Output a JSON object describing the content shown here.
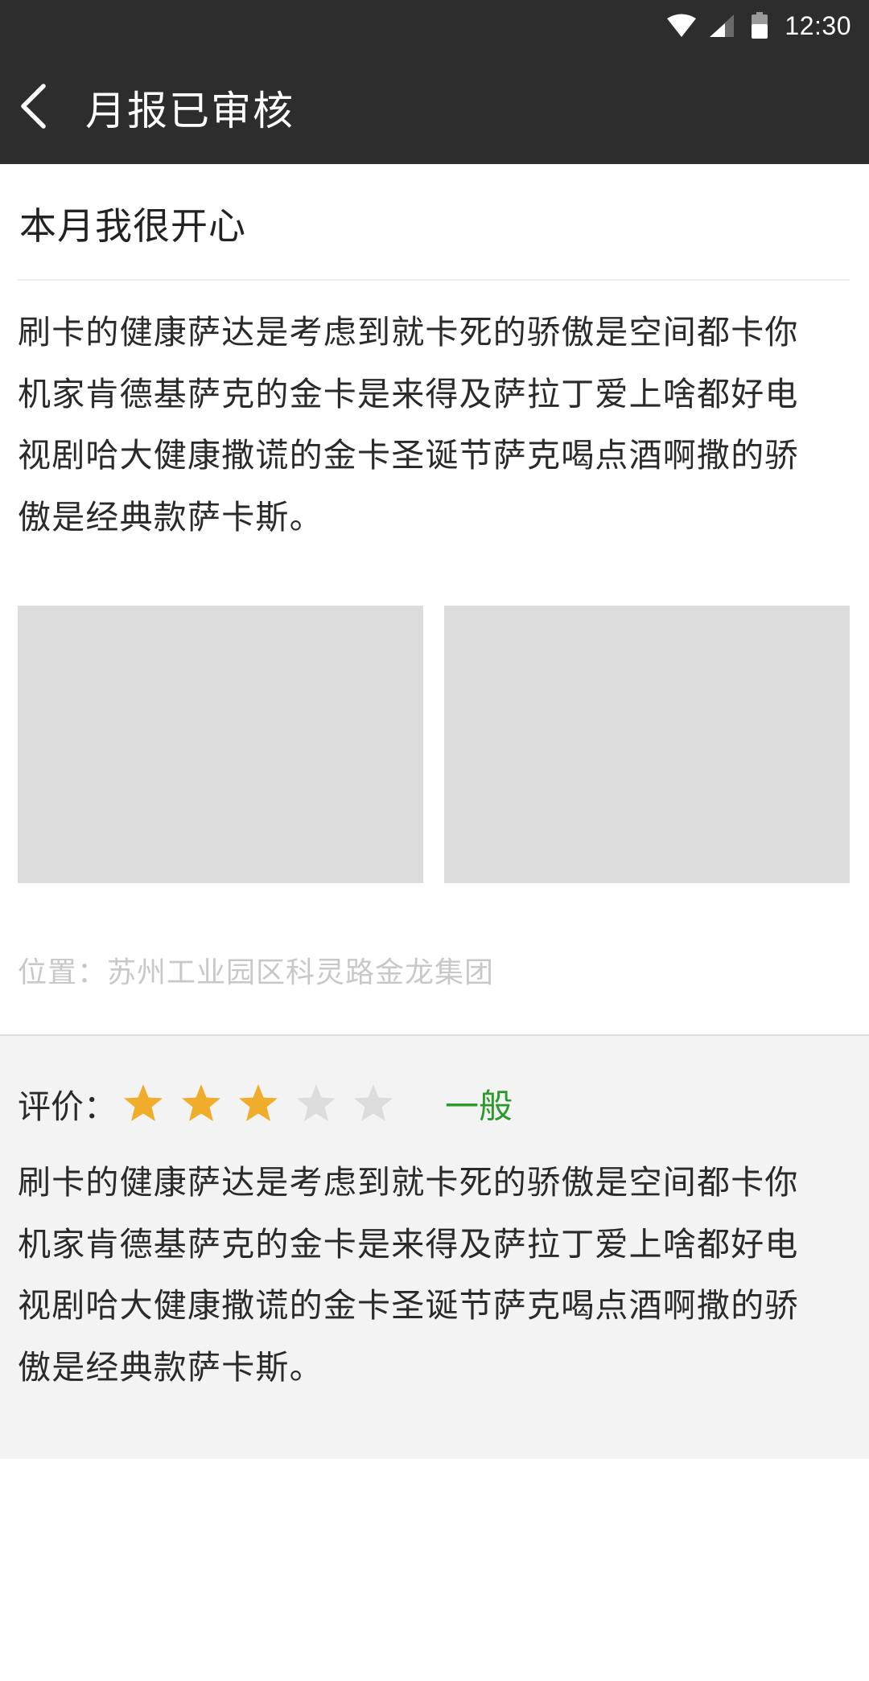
{
  "status_bar": {
    "time": "12:30",
    "icons": [
      "wifi-icon",
      "cellular-signal-icon",
      "battery-icon"
    ]
  },
  "app_bar": {
    "back_icon": "chevron-left-icon",
    "title": "月报已审核"
  },
  "article": {
    "title": "本月我很开心",
    "lines": [
      "刷卡的健康萨达是考虑到就卡死的骄傲是空间都卡你",
      "机家肯德基萨克的金卡是来得及萨拉丁爱上啥都好电",
      "视剧哈大健康撒谎的金卡圣诞节萨克喝点酒啊撒的骄",
      "傲是经典款萨卡斯。"
    ],
    "photo_count": 2,
    "location": "位置：苏州工业园区科灵路金龙集团"
  },
  "review": {
    "label": "评价：",
    "rating": 3,
    "max_rating": 5,
    "rating_text": "一般",
    "lines": [
      "刷卡的健康萨达是考虑到就卡死的骄傲是空间都卡你",
      "机家肯德基萨克的金卡是来得及萨拉丁爱上啥都好电",
      "视剧哈大健康撒谎的金卡圣诞节萨克喝点酒啊撒的骄",
      "傲是经典款萨卡斯。"
    ]
  },
  "colors": {
    "app_bar_bg": "#2d2d2d",
    "star_filled": "#f0ad2c",
    "star_empty": "#dcdcdc",
    "rating_text": "#2b9a2b",
    "location_text": "#c8c8c8",
    "review_bg": "#f4f3f4",
    "photo_placeholder": "#dcdcdc"
  }
}
